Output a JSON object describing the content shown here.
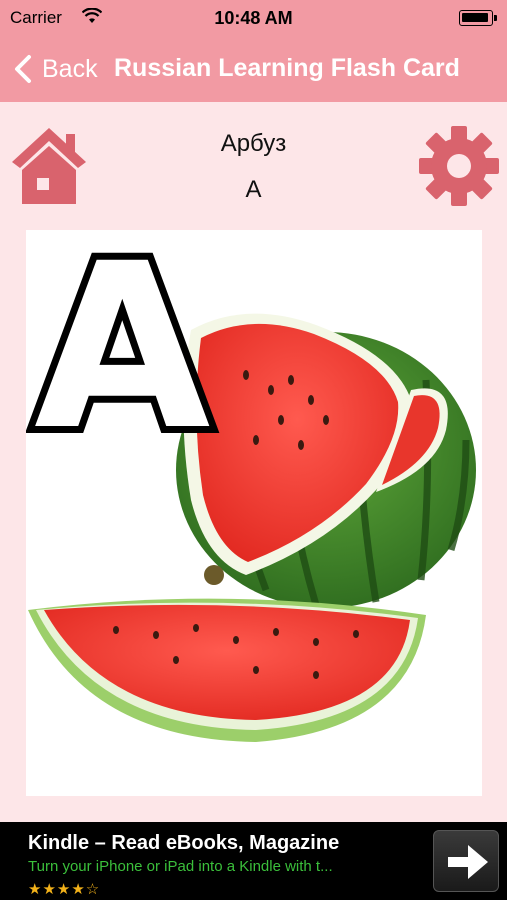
{
  "status_bar": {
    "carrier": "Carrier",
    "time": "10:48 AM"
  },
  "nav": {
    "back_label": "Back",
    "title": "Russian Learning Flash Card"
  },
  "card": {
    "word": "Арбуз",
    "letter": "А",
    "big_letter": "A"
  },
  "ad": {
    "title": "Kindle – Read eBooks, Magazine",
    "subtitle": "Turn your iPhone or iPad into a Kindle with t...",
    "stars": "★★★★☆"
  },
  "colors": {
    "accent": "#f29aa3",
    "icon": "#d9636d",
    "background": "#fde6e8"
  }
}
